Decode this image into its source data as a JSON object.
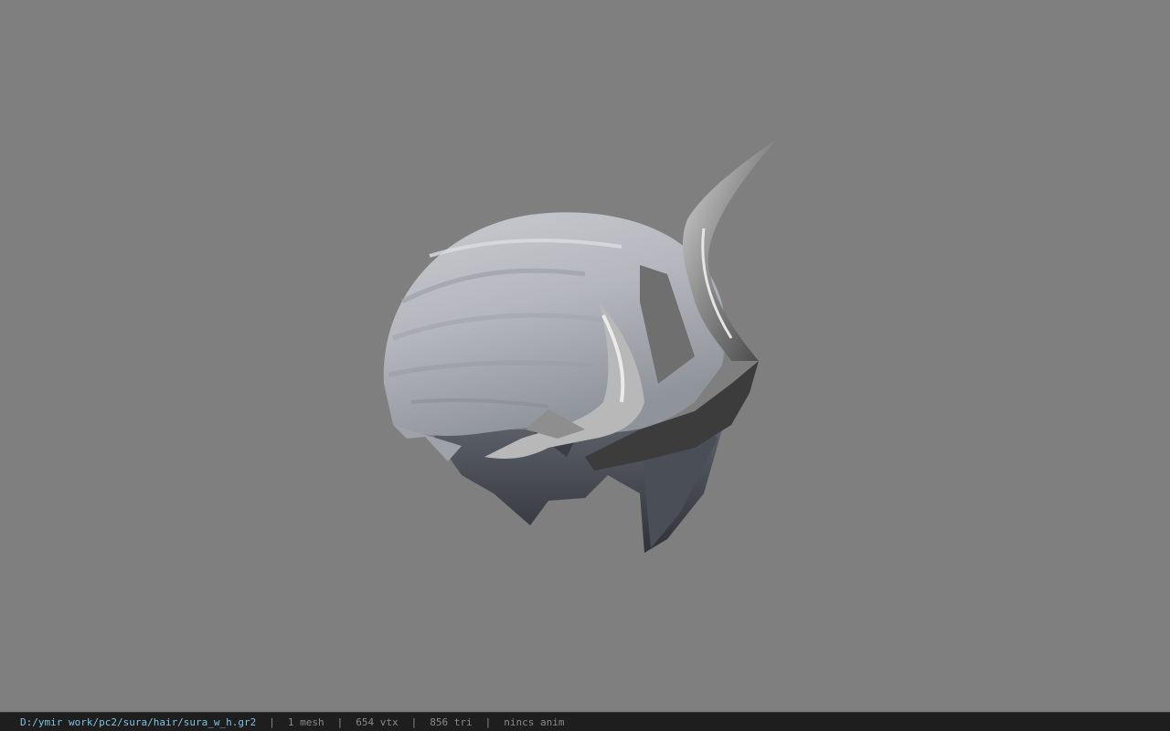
{
  "viewer": {
    "background_color": "#7f7f7f",
    "model_icon": "hair-helmet-mesh"
  },
  "status": {
    "file_path": "D:/ymir work/pc2/sura/hair/sura_w_h.gr2",
    "separator": "|",
    "mesh_count": "1 mesh",
    "vertex_count": "654 vtx",
    "triangle_count": "856 tri",
    "anim": "nincs anim",
    "path_color": "#7fc3e0",
    "text_color": "#8a8a8a",
    "bar_color": "#1e1e1e"
  }
}
